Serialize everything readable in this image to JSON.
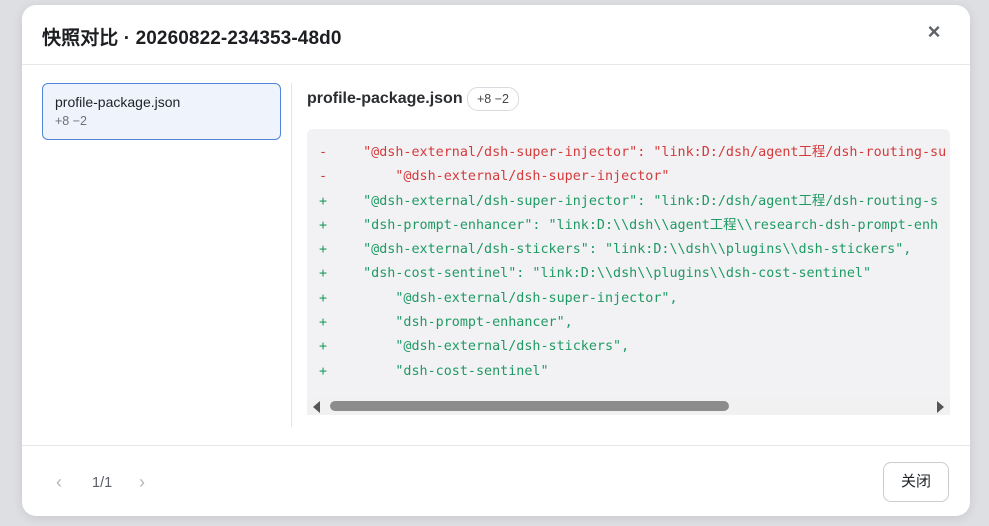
{
  "modal": {
    "title": "快照对比 · 20260822-234353-48d0",
    "close_icon": "×"
  },
  "file_list": [
    {
      "name": "profile-package.json",
      "stat": "+8 −2",
      "selected": true
    }
  ],
  "diff": {
    "filename": "profile-package.json",
    "badge": "+8 −2",
    "lines": [
      {
        "sign": "-",
        "type": "del",
        "text": "  \"@dsh-external/dsh-super-injector\": \"link:D:/dsh/agent工程/dsh-routing-su"
      },
      {
        "sign": "-",
        "type": "del",
        "text": "      \"@dsh-external/dsh-super-injector\""
      },
      {
        "sign": "+",
        "type": "add",
        "text": "  \"@dsh-external/dsh-super-injector\": \"link:D:/dsh/agent工程/dsh-routing-s"
      },
      {
        "sign": "+",
        "type": "add",
        "text": "  \"dsh-prompt-enhancer\": \"link:D:\\\\dsh\\\\agent工程\\\\research-dsh-prompt-enh"
      },
      {
        "sign": "+",
        "type": "add",
        "text": "  \"@dsh-external/dsh-stickers\": \"link:D:\\\\dsh\\\\plugins\\\\dsh-stickers\","
      },
      {
        "sign": "+",
        "type": "add",
        "text": "  \"dsh-cost-sentinel\": \"link:D:\\\\dsh\\\\plugins\\\\dsh-cost-sentinel\""
      },
      {
        "sign": "+",
        "type": "add",
        "text": "      \"@dsh-external/dsh-super-injector\","
      },
      {
        "sign": "+",
        "type": "add",
        "text": "      \"dsh-prompt-enhancer\","
      },
      {
        "sign": "+",
        "type": "add",
        "text": "      \"@dsh-external/dsh-stickers\","
      },
      {
        "sign": "+",
        "type": "add",
        "text": "      \"dsh-cost-sentinel\""
      }
    ],
    "scroll_position": 0
  },
  "footer": {
    "prev_icon": "‹",
    "page_text": "1/1",
    "next_icon": "›",
    "close_label": "关闭"
  },
  "colors": {
    "deleted": "#d43a3a",
    "added": "#1f9a63",
    "accent": "#4f86d9"
  }
}
